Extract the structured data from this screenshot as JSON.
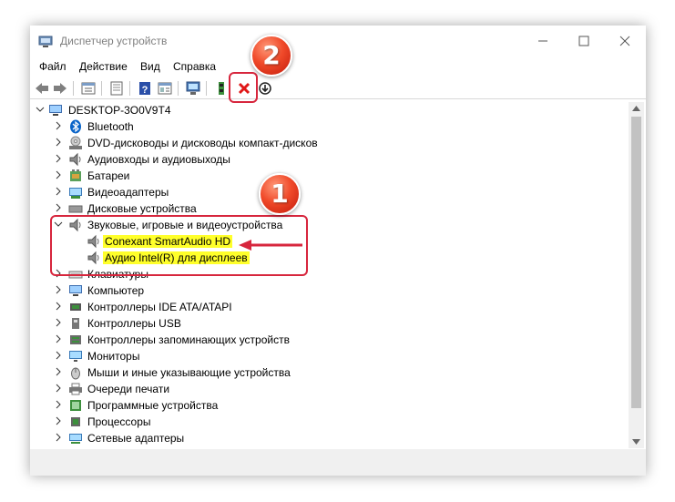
{
  "window": {
    "title": "Диспетчер устройств"
  },
  "menu": [
    "Файл",
    "Действие",
    "Вид",
    "Справка"
  ],
  "toolbar": {
    "items": [
      "back-icon",
      "forward-icon",
      "properties-icon",
      "show-hidden-icon",
      "help-icon",
      "properties-sheet-icon",
      "scan-hardware-icon",
      "update-driver-icon",
      "uninstall-device-icon",
      "download-driver-icon"
    ]
  },
  "tree": {
    "root": "DESKTOP-3O0V9T4",
    "items": [
      {
        "label": "Bluetooth",
        "icon": "bluetooth-icon"
      },
      {
        "label": "DVD-дисководы и дисководы компакт-дисков",
        "icon": "dvd-drive-icon"
      },
      {
        "label": "Аудиовходы и аудиовыходы",
        "icon": "speaker-icon"
      },
      {
        "label": "Батареи",
        "icon": "battery-icon"
      },
      {
        "label": "Видеоадаптеры",
        "icon": "display-adapter-icon"
      },
      {
        "label": "Дисковые устройства",
        "icon": "disk-drive-icon"
      },
      {
        "label": "Звуковые, игровые и видеоустройства",
        "icon": "speaker-icon",
        "expanded": true,
        "children": [
          "Conexant SmartAudio HD",
          "Аудио Intel(R) для дисплеев"
        ]
      },
      {
        "label": "Клавиатуры",
        "icon": "keyboard-icon"
      },
      {
        "label": "Компьютер",
        "icon": "computer-icon"
      },
      {
        "label": "Контроллеры IDE ATA/ATAPI",
        "icon": "ide-controller-icon"
      },
      {
        "label": "Контроллеры USB",
        "icon": "usb-controller-icon"
      },
      {
        "label": "Контроллеры запоминающих устройств",
        "icon": "storage-controller-icon"
      },
      {
        "label": "Мониторы",
        "icon": "monitor-icon"
      },
      {
        "label": "Мыши и иные указывающие устройства",
        "icon": "mouse-icon"
      },
      {
        "label": "Очереди печати",
        "icon": "printer-icon"
      },
      {
        "label": "Программные устройства",
        "icon": "software-device-icon"
      },
      {
        "label": "Процессоры",
        "icon": "processor-icon"
      },
      {
        "label": "Сетевые адаптеры",
        "icon": "network-adapter-icon"
      }
    ]
  },
  "annotations": {
    "badge1": "1",
    "badge2": "2"
  },
  "colors": {
    "highlight": "#ffff2a",
    "annotation_red": "#d7263d",
    "bluetooth": "#0a64c8"
  }
}
